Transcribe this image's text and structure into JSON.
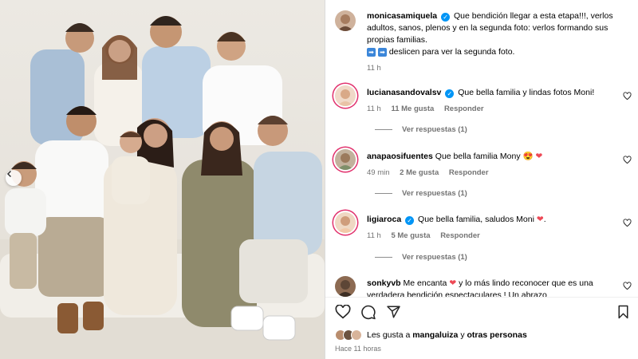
{
  "post": {
    "author": "monicasamiquela",
    "caption_text": "Que bendición llegar a esta etapa!!!, verlos adultos, sanos, plenos y en la segunda foto: verlos formando sus propias familias.",
    "caption_line2": "deslicen para ver la segunda foto.",
    "caption_time": "11 h",
    "arrow_icon": "right-arrow-emoji-icon"
  },
  "comments": [
    {
      "user": "lucianasandovalsv",
      "verified": true,
      "text": "Que bella familia y lindas fotos Moni!",
      "time": "11 h",
      "likes": "11 Me gusta",
      "reply": "Responder",
      "view_replies": "Ver respuestas (1)"
    },
    {
      "user": "anapaosifuentes",
      "verified": false,
      "text": "Que bella familia Mony",
      "time": "49 min",
      "likes": "2 Me gusta",
      "reply": "Responder",
      "view_replies": "Ver respuestas (1)"
    },
    {
      "user": "ligiaroca",
      "verified": true,
      "text": "Que bella familia, saludos Moni",
      "time": "11 h",
      "likes": "5 Me gusta",
      "reply": "Responder",
      "view_replies": "Ver respuestas (1)"
    },
    {
      "user": "sonkyvb",
      "verified": false,
      "text": "Me encanta",
      "text_cont": "y lo más lindo reconocer que es una verdadera bendición",
      "text_tail": "espectaculares ! Un abrazo"
    }
  ],
  "footer": {
    "likes_prefix": "Les gusta a",
    "likes_user": "mangaluiza",
    "likes_mid": "y",
    "likes_others": "otras personas",
    "time_ago": "Hace 11 horas"
  },
  "colors": {
    "accent": "#0095f6",
    "heart": "#ed4956",
    "muted": "#737373"
  },
  "icons": [
    "heart-icon",
    "comment-icon",
    "share-icon",
    "bookmark-icon",
    "carousel-prev-icon",
    "verified-icon"
  ]
}
